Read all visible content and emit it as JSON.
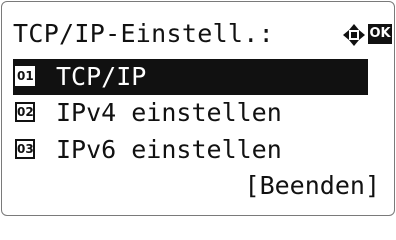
{
  "header": {
    "title": "TCP/IP-Einstell.:",
    "nav_icon": "four-way-arrow-icon",
    "ok_label": "OK"
  },
  "menu": {
    "items": [
      {
        "number": "01",
        "label": "TCP/IP",
        "selected": true
      },
      {
        "number": "02",
        "label": "IPv4 einstellen",
        "selected": false
      },
      {
        "number": "03",
        "label": "IPv6 einstellen",
        "selected": false
      }
    ]
  },
  "footer": {
    "finish_label": "[Beenden]"
  },
  "colors": {
    "highlight_bg": "#111111",
    "highlight_fg": "#ffffff",
    "text": "#111111"
  }
}
